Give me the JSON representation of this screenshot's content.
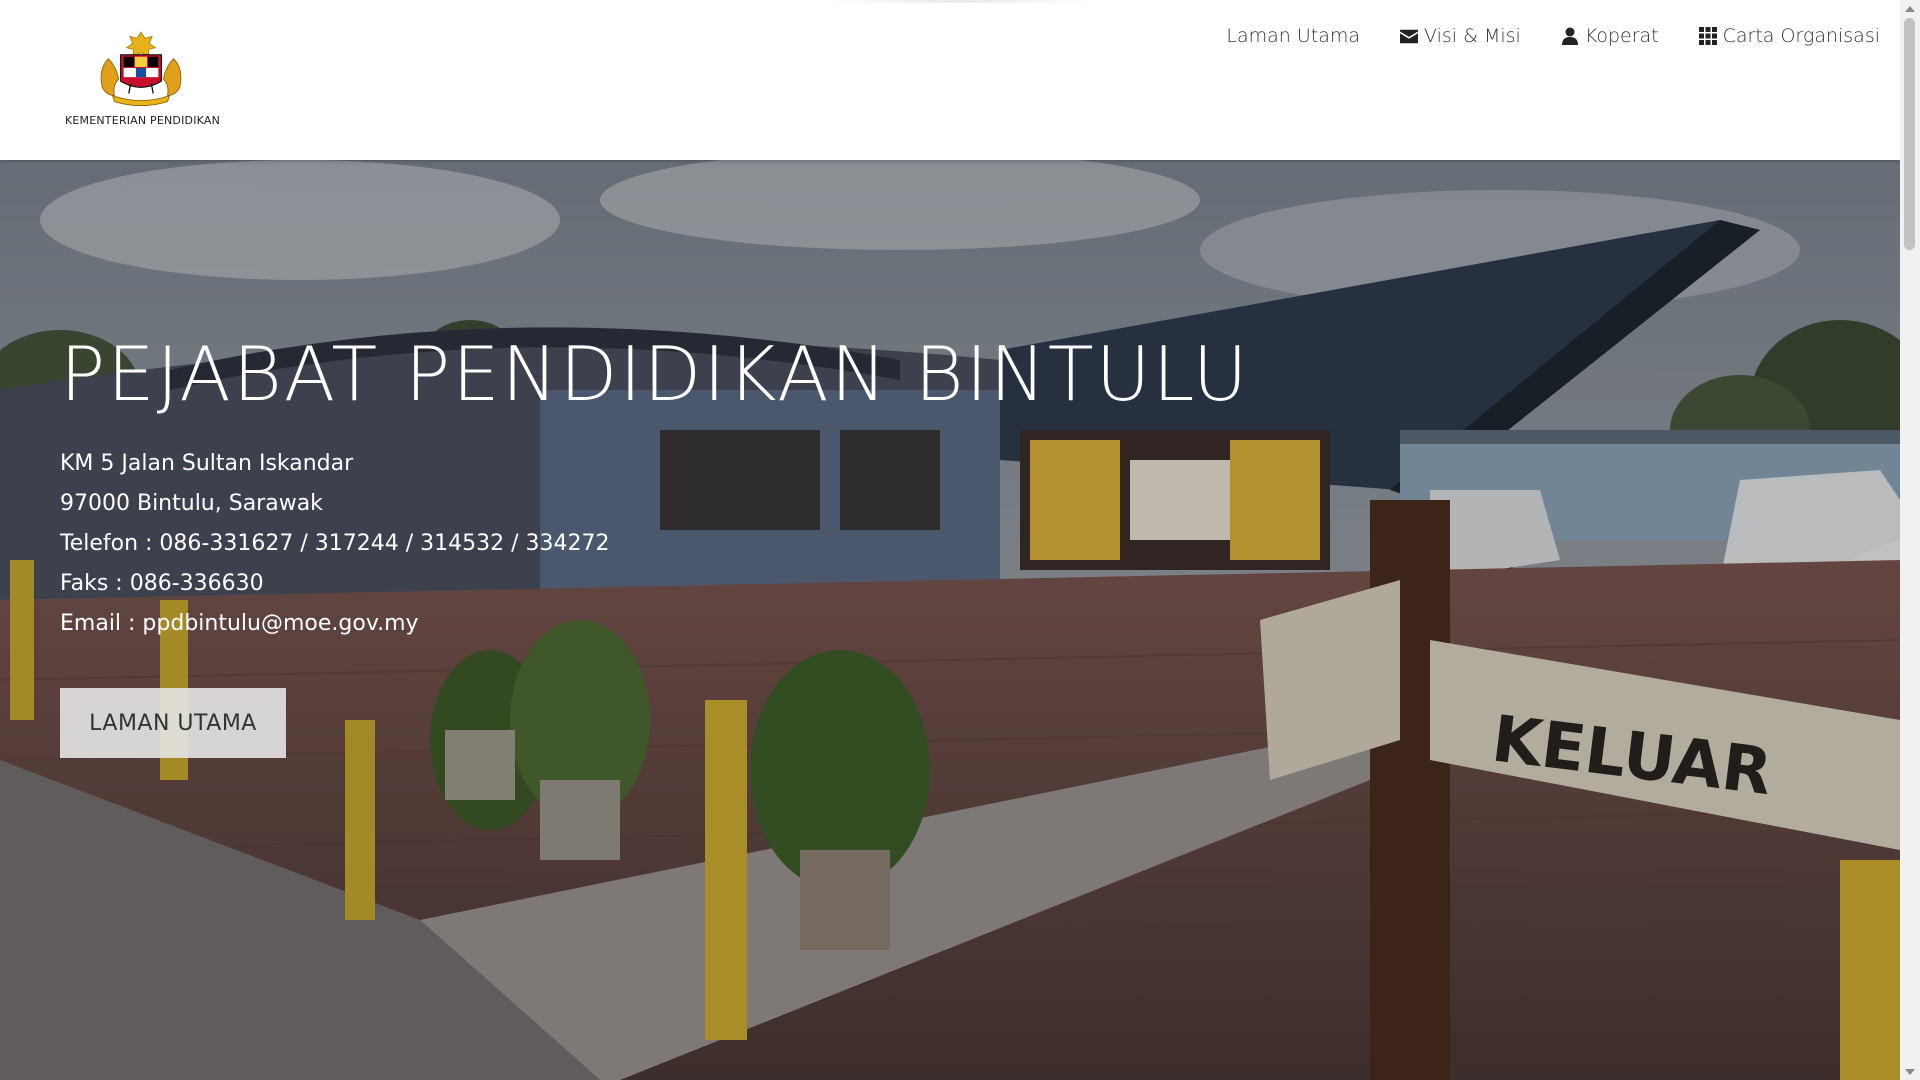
{
  "header": {
    "logo_text": "KEMENTERIAN PENDIDIKAN",
    "nav": [
      {
        "label": "Laman Utama",
        "icon": ""
      },
      {
        "label": "Visi & Misi",
        "icon": "envelope-icon"
      },
      {
        "label": "Koperat",
        "icon": "user-icon"
      },
      {
        "label": "Carta Organisasi",
        "icon": "grid-icon"
      }
    ]
  },
  "hero": {
    "title": "PEJABAT PENDIDIKAN BINTULU",
    "address_lines": [
      "KM 5 Jalan Sultan Iskandar",
      "97000 Bintulu, Sarawak",
      "Telefon : 086-331627 / 317244 / 314532 / 334272",
      "Faks : 086-336630",
      "Email : ppdbintulu@moe.gov.my"
    ],
    "button_label": "LAMAN UTAMA",
    "sign_text": "KELUAR"
  },
  "colors": {
    "header_bg": "#ffffff",
    "nav_text": "#333333",
    "hero_text": "#ffffff",
    "button_bg": "#e6e6e6"
  }
}
